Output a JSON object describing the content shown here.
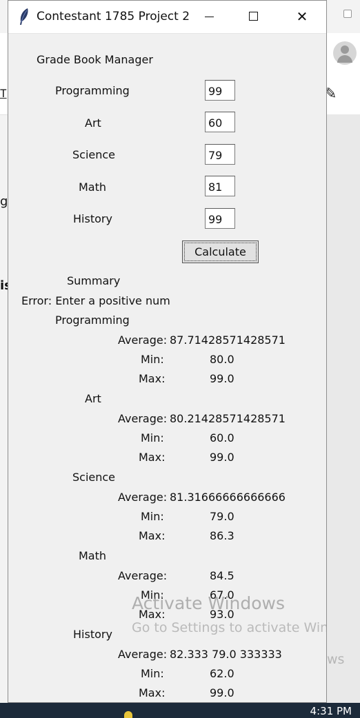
{
  "window": {
    "title": "Contestant 1785 Project 2",
    "close_glyph": "✕"
  },
  "app": {
    "heading": "Grade Book Manager",
    "subjects": [
      {
        "label": "Programming",
        "value": "99"
      },
      {
        "label": "Art",
        "value": "60"
      },
      {
        "label": "Science",
        "value": "79"
      },
      {
        "label": "Math",
        "value": "81"
      },
      {
        "label": "History",
        "value": "99"
      }
    ],
    "calculate_label": "Calculate",
    "summary_label": "Summary",
    "error_text": "Error: Enter a positive num",
    "stat_labels": {
      "average": "Average:",
      "min": "Min:",
      "max": "Max:"
    },
    "summary": [
      {
        "subject": "Programming",
        "average": "87.71428571428571",
        "min": "80.0",
        "max": "99.0"
      },
      {
        "subject": "Art",
        "average": "80.21428571428571",
        "min": "60.0",
        "max": "99.0"
      },
      {
        "subject": "Science",
        "average": "81.31666666666666",
        "min": "79.0",
        "max": "86.3"
      },
      {
        "subject": "Math",
        "average": "84.5",
        "min": "67.0",
        "max": "93.0"
      },
      {
        "subject": "History",
        "average": "82.333 79.0 333333",
        "min": "62.0",
        "max": "99.0"
      }
    ]
  },
  "overlay": {
    "activate_title": "Activate Windows",
    "activate_sub": "Go to Settings to activate Windows",
    "activate_sub_overflow": "ws"
  },
  "background": {
    "toolbar_t": "T",
    "frag1": "g",
    "frag2": "is"
  },
  "taskbar": {
    "clock": "4:31 PM"
  }
}
